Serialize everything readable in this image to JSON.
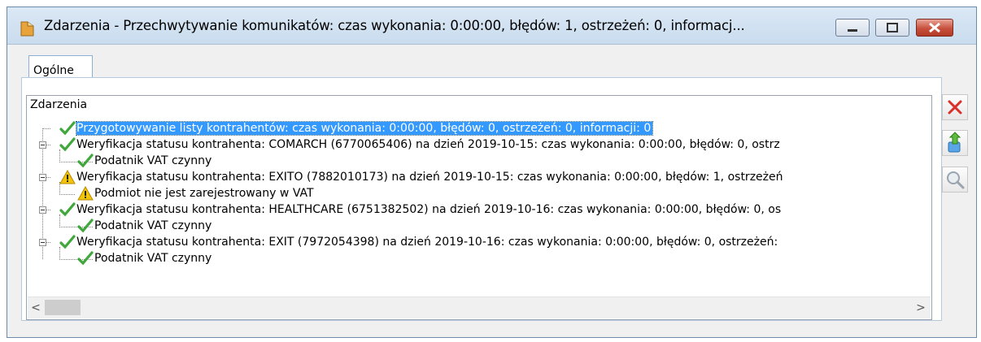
{
  "window": {
    "title": "Zdarzenia - Przechwytywanie komunikatów: czas wykonania:  0:00:00, błędów: 1, ostrzeżeń: 0, informacj...",
    "icon": "folder-icon",
    "buttons": [
      "minimize-icon",
      "maximize-icon",
      "close-icon"
    ]
  },
  "tabs": [
    {
      "label": "Ogólne",
      "active": true
    }
  ],
  "tree": {
    "header": "Zdarzenia",
    "rows": [
      {
        "text": "Przygotowywanie listy kontrahentów: czas wykonania:  0:00:00, błędów: 0, ostrzeżeń: 0, informacji: 0",
        "status": "ok",
        "level": 0,
        "selected": true
      },
      {
        "text": "Weryfikacja statusu kontrahenta: COMARCH (6770065406) na dzień 2019-10-15: czas wykonania:  0:00:00, błędów: 0, ostrz",
        "status": "ok",
        "level": 0
      },
      {
        "text": "Podatnik VAT czynny",
        "status": "ok",
        "level": 1
      },
      {
        "text": "Weryfikacja statusu kontrahenta: EXITO (7882010173) na dzień 2019-10-15: czas wykonania:  0:00:00, błędów: 1, ostrzeżeń",
        "status": "warning",
        "level": 0
      },
      {
        "text": "Podmiot nie jest zarejestrowany w VAT",
        "status": "warning",
        "level": 1
      },
      {
        "text": "Weryfikacja statusu kontrahenta: HEALTHCARE (6751382502) na dzień 2019-10-16: czas wykonania:  0:00:00, błędów: 0, os",
        "status": "ok",
        "level": 0
      },
      {
        "text": "Podatnik VAT czynny",
        "status": "ok",
        "level": 1
      },
      {
        "text": "Weryfikacja statusu kontrahenta: EXIT (7972054398) na dzień 2019-10-16: czas wykonania:  0:00:00, błędów: 0, ostrzeżeń:",
        "status": "ok",
        "level": 0
      },
      {
        "text": "Podatnik VAT czynny",
        "status": "ok",
        "level": 1
      }
    ]
  },
  "scrollbar": {
    "left_arrow": "<",
    "right_arrow": ">"
  },
  "side_buttons": [
    {
      "icon": "delete-x-icon"
    },
    {
      "icon": "export-icon"
    },
    {
      "icon": "magnifier-icon"
    }
  ],
  "colors": {
    "selection": "#3399ff",
    "ok": "#3fa83a",
    "warning": "#f2c40c",
    "delete": "#d9302a"
  }
}
